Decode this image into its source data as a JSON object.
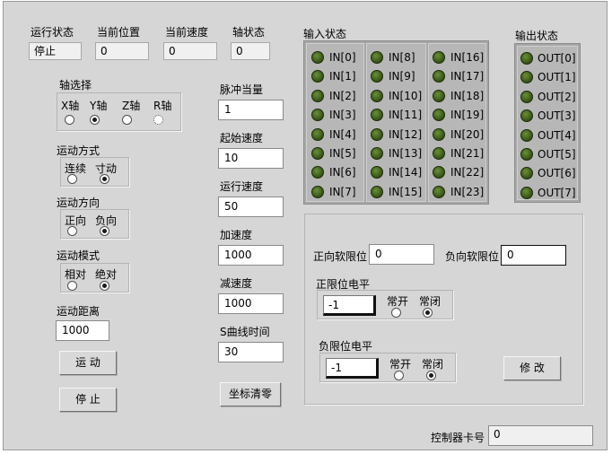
{
  "status": {
    "run_state_label": "运行状态",
    "run_state_value": "停止",
    "position_label": "当前位置",
    "position_value": "0",
    "speed_label": "当前速度",
    "speed_value": "0",
    "axis_state_label": "轴状态",
    "axis_state_value": "0"
  },
  "axis_select": {
    "label": "轴选择",
    "options": [
      "X轴",
      "Y轴",
      "Z轴",
      "R轴"
    ],
    "selected": "Y轴"
  },
  "motion_mode": {
    "label": "运动方式",
    "options": [
      "连续",
      "寸动"
    ],
    "selected": "寸动"
  },
  "motion_direction": {
    "label": "运动方向",
    "options": [
      "正向",
      "负向"
    ],
    "selected": "负向"
  },
  "motion_pattern": {
    "label": "运动模式",
    "options": [
      "相对",
      "绝对"
    ],
    "selected": "绝对"
  },
  "distance": {
    "label": "运动距离",
    "value": "1000"
  },
  "buttons": {
    "move": "运 动",
    "stop": "停 止",
    "clear_coords": "坐标清零",
    "modify": "修 改"
  },
  "params": {
    "pulse_equiv_label": "脉冲当量",
    "pulse_equiv_value": "1",
    "start_speed_label": "起始速度",
    "start_speed_value": "10",
    "run_speed_label": "运行速度",
    "run_speed_value": "50",
    "accel_label": "加速度",
    "accel_value": "1000",
    "decel_label": "减速度",
    "decel_value": "1000",
    "s_curve_label": "S曲线时间",
    "s_curve_value": "30"
  },
  "inputs": {
    "label": "输入状态",
    "items": [
      "IN[0]",
      "IN[1]",
      "IN[2]",
      "IN[3]",
      "IN[4]",
      "IN[5]",
      "IN[6]",
      "IN[7]",
      "IN[8]",
      "IN[9]",
      "IN[10]",
      "IN[11]",
      "IN[12]",
      "IN[13]",
      "IN[14]",
      "IN[15]",
      "IN[16]",
      "IN[17]",
      "IN[18]",
      "IN[19]",
      "IN[20]",
      "IN[21]",
      "IN[22]",
      "IN[23]"
    ]
  },
  "outputs": {
    "label": "输出状态",
    "items": [
      "OUT[0]",
      "OUT[1]",
      "OUT[2]",
      "OUT[3]",
      "OUT[4]",
      "OUT[5]",
      "OUT[6]",
      "OUT[7]"
    ]
  },
  "limits": {
    "pos_soft_label": "正向软限位",
    "pos_soft_value": "0",
    "neg_soft_label": "负向软限位",
    "neg_soft_value": "0",
    "pos_level_label": "正限位电平",
    "pos_level_value": "-1",
    "pos_level_options": [
      "常开",
      "常闭"
    ],
    "pos_level_selected": "常闭",
    "neg_level_label": "负限位电平",
    "neg_level_value": "-1",
    "neg_level_options": [
      "常开",
      "常闭"
    ],
    "neg_level_selected": "常闭"
  },
  "controller": {
    "card_label": "控制器卡号",
    "card_value": "0"
  }
}
